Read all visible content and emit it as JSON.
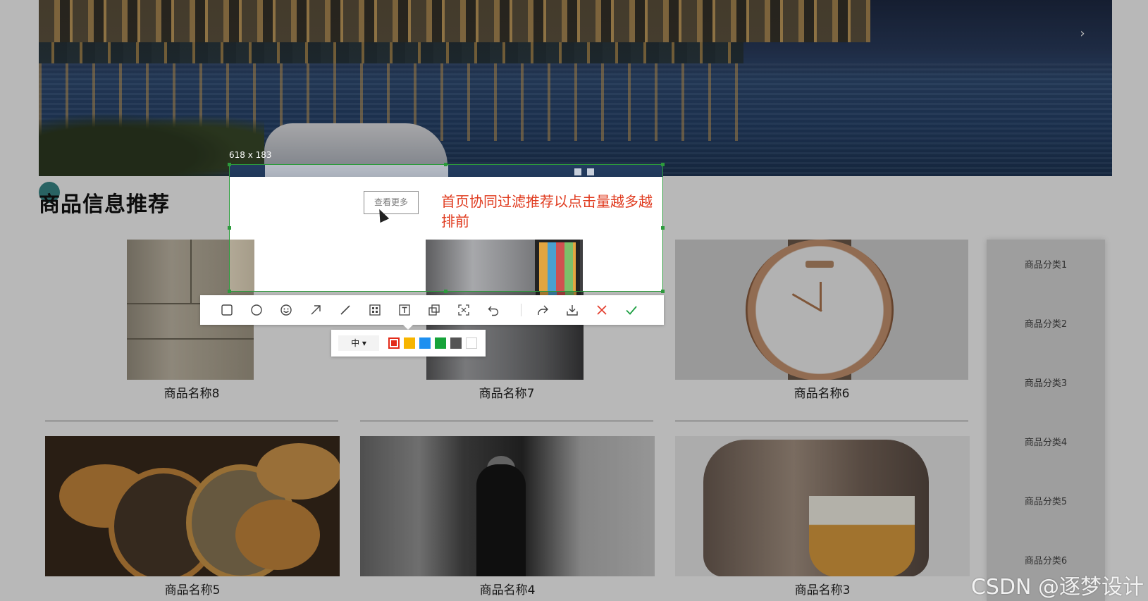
{
  "banner": {
    "next_arrow": "›"
  },
  "section": {
    "title": "商品信息推荐"
  },
  "products": [
    {
      "name": "商品名称8"
    },
    {
      "name": "商品名称7"
    },
    {
      "name": "商品名称6"
    },
    {
      "name": "商品名称5"
    },
    {
      "name": "商品名称4"
    },
    {
      "name": "商品名称3"
    }
  ],
  "categories": [
    "商品分类1",
    "商品分类2",
    "商品分类3",
    "商品分类4",
    "商品分类5",
    "商品分类6"
  ],
  "capture": {
    "size_label": "618 x 183",
    "more_button": "查看更多",
    "annotation_text": "首页协同过滤推荐以点击量越多越排前"
  },
  "toolbar": {
    "tools": [
      "rectangle-icon",
      "ellipse-icon",
      "emoji-icon",
      "arrow-icon",
      "line-icon",
      "mosaic-icon",
      "text-icon",
      "pin-icon",
      "ocr-icon",
      "undo-icon",
      "share-icon",
      "download-icon",
      "cancel-icon",
      "confirm-icon"
    ]
  },
  "palette": {
    "size_value": "中",
    "size_caret": "▾",
    "colors": [
      "#e32b1a",
      "#f7b500",
      "#1e90f0",
      "#16a33a",
      "#555555",
      "#ffffff"
    ],
    "selected_color": "#e32b1a"
  },
  "watermark": "CSDN @逐梦设计"
}
